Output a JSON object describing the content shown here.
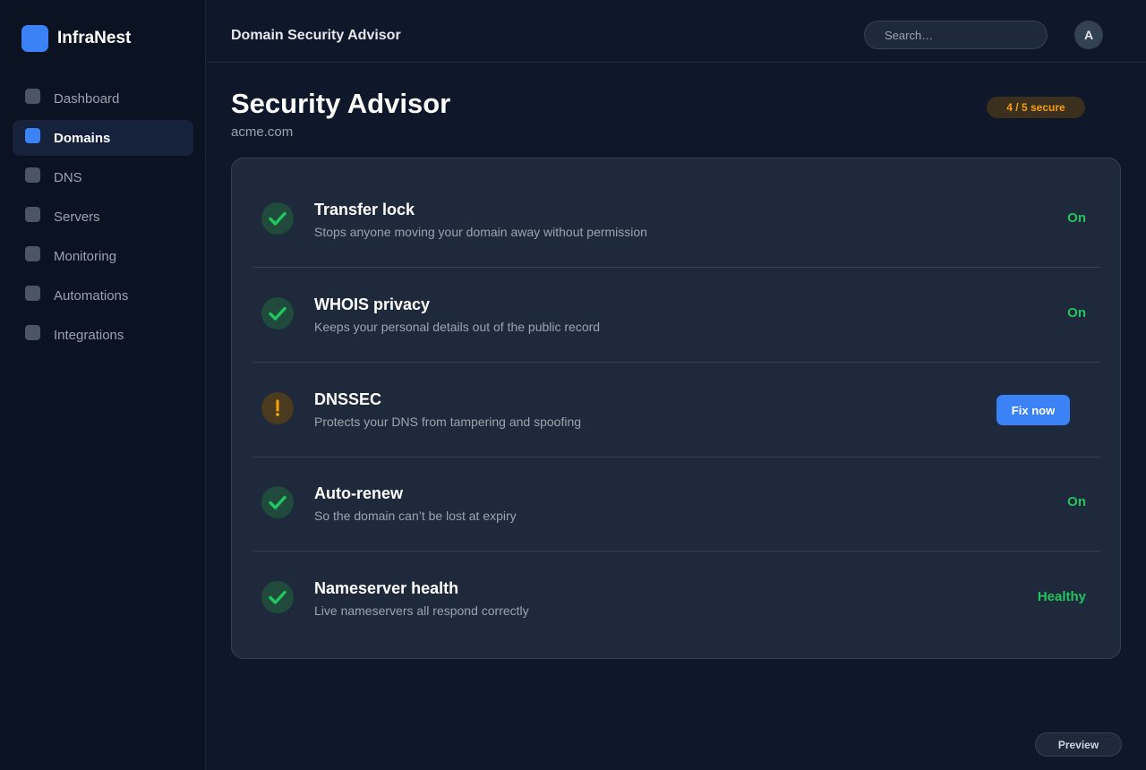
{
  "app": {
    "name": "InfraNest"
  },
  "colors": {
    "accent": "#3b82f6",
    "success": "#22c55e",
    "warning": "#f59e0b",
    "background": "#0f172a"
  },
  "sidebar": {
    "items": [
      {
        "label": "Dashboard",
        "icon": "dashboard-icon",
        "active": false
      },
      {
        "label": "Domains",
        "icon": "domains-icon",
        "active": true
      },
      {
        "label": "DNS",
        "icon": "dns-icon",
        "active": false
      },
      {
        "label": "Servers",
        "icon": "servers-icon",
        "active": false
      },
      {
        "label": "Monitoring",
        "icon": "monitoring-icon",
        "active": false
      },
      {
        "label": "Automations",
        "icon": "automations-icon",
        "active": false
      },
      {
        "label": "Integrations",
        "icon": "integrations-icon",
        "active": false
      }
    ]
  },
  "header": {
    "title": "Domain Security Advisor",
    "search_placeholder": "Search…",
    "avatar_initial": "A"
  },
  "main": {
    "title": "Security Advisor",
    "domain": "acme.com",
    "badge": "4 / 5 secure",
    "checks": [
      {
        "title": "Transfer lock",
        "description": "Stops anyone moving your domain away without permission",
        "state": "ok",
        "status": "On",
        "icon": "check-icon"
      },
      {
        "title": "WHOIS privacy",
        "description": "Keeps your personal details out of the public record",
        "state": "ok",
        "status": "On",
        "icon": "check-icon"
      },
      {
        "title": "DNSSEC",
        "description": "Protects your DNS from tampering and spoofing",
        "state": "warn",
        "action_label": "Fix now",
        "icon": "warning-icon"
      },
      {
        "title": "Auto-renew",
        "description": "So the domain can’t be lost at expiry",
        "state": "ok",
        "status": "On",
        "icon": "check-icon"
      },
      {
        "title": "Nameserver health",
        "description": "Live nameservers all respond correctly",
        "state": "ok",
        "status": "Healthy",
        "icon": "check-icon"
      }
    ]
  },
  "footer": {
    "preview_label": "Preview"
  }
}
